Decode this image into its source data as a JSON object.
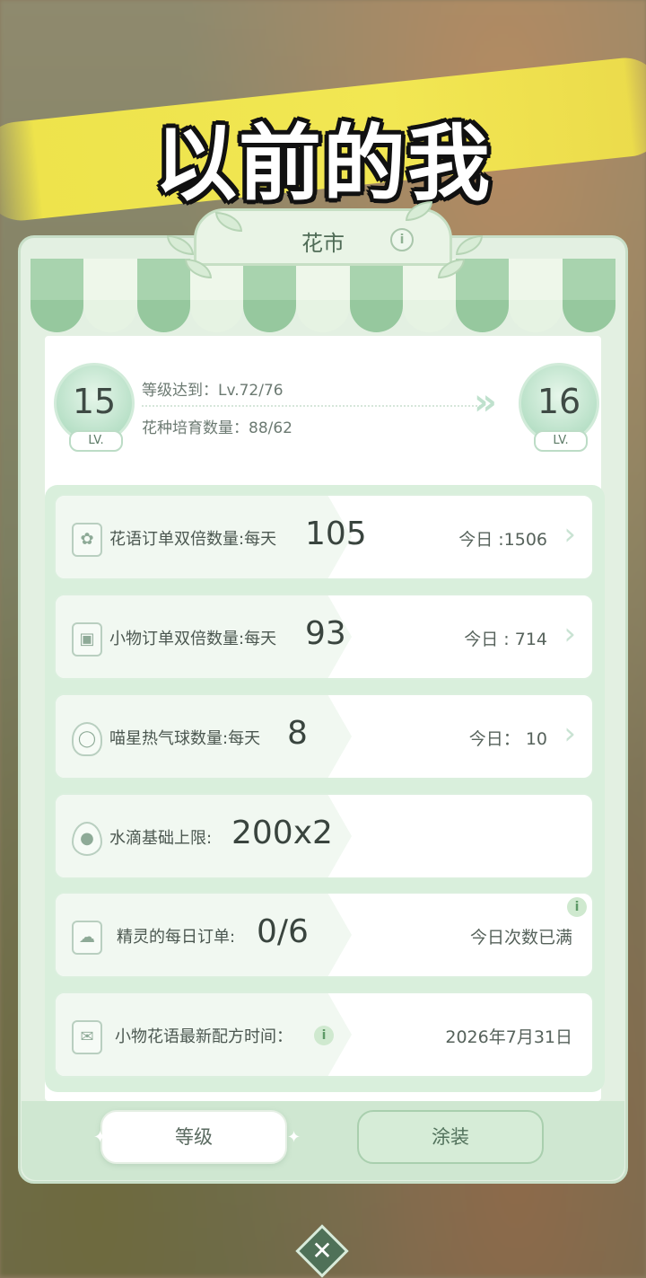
{
  "caption": "以前的我",
  "panel": {
    "title": "花市",
    "info_glyph": "i"
  },
  "level": {
    "current": "15",
    "next": "16",
    "lv_tag": "LV.",
    "req_level": "等级达到：Lv.72/76",
    "req_seeds": "花种培育数量：88/62"
  },
  "rows": [
    {
      "icon": "clipboard-flower-icon",
      "label": "花语订单双倍数量:每天",
      "value": "105",
      "today": "今日 :1506",
      "has_arrow": true
    },
    {
      "icon": "clipboard-item-icon",
      "label": "小物订单双倍数量:每天",
      "value": "93",
      "today": "今日 : 714",
      "has_arrow": true
    },
    {
      "icon": "balloon-icon",
      "label": "喵星热气球数量:每天",
      "value": "8",
      "today": "今日： 10",
      "has_arrow": true
    },
    {
      "icon": "water-drop-icon",
      "label": "水滴基础上限:",
      "value": "200x2",
      "today": "",
      "has_arrow": false
    },
    {
      "icon": "spirit-icon",
      "label": "精灵的每日订单:",
      "value": "0/6",
      "today": "今日次数已满",
      "has_arrow": false
    },
    {
      "icon": "recipe-bag-icon",
      "label": "小物花语最新配方时间：",
      "value": "",
      "today": "2026年7月31日",
      "has_arrow": false
    }
  ],
  "footer": {
    "level_button": "等级",
    "paint_button": "涂装"
  },
  "close_glyph": "✕",
  "colors": {
    "accent": "#a8d3ae",
    "text": "#4b5750",
    "caption_highlight": "#f3e84a"
  }
}
